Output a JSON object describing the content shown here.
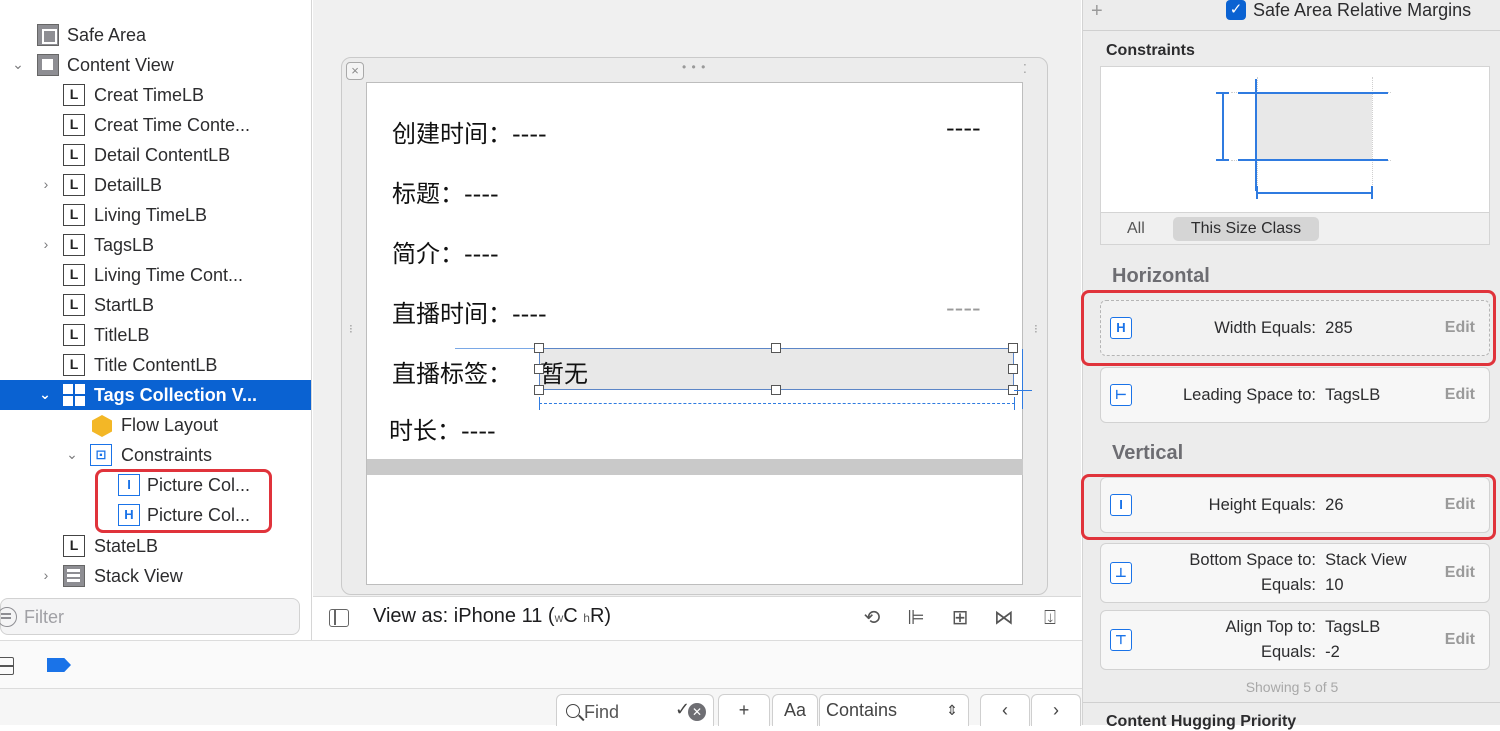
{
  "outline": {
    "items": [
      {
        "label": "Safe Area"
      },
      {
        "label": "Content View"
      },
      {
        "label": "Creat TimeLB"
      },
      {
        "label": "Creat Time Conte..."
      },
      {
        "label": "Detail ContentLB"
      },
      {
        "label": "DetailLB"
      },
      {
        "label": "Living TimeLB"
      },
      {
        "label": "TagsLB"
      },
      {
        "label": "Living Time Cont..."
      },
      {
        "label": "StartLB"
      },
      {
        "label": "TitleLB"
      },
      {
        "label": "Title ContentLB"
      },
      {
        "label": "Tags Collection V..."
      },
      {
        "label": "Flow Layout"
      },
      {
        "label": "Constraints"
      },
      {
        "label": "Picture Col..."
      },
      {
        "label": "Picture Col..."
      },
      {
        "label": "StateLB"
      },
      {
        "label": "Stack View"
      }
    ],
    "label_icon_letter": "L",
    "filter_placeholder": "Filter"
  },
  "canvas": {
    "rows": [
      {
        "label": "创建时间：----",
        "trailing": "----"
      },
      {
        "label": "标题：----"
      },
      {
        "label": "简介：----"
      },
      {
        "label": "直播时间：----",
        "trailing": "----"
      },
      {
        "label": "直播标签：",
        "value": "暂无"
      },
      {
        "label": "时长：----"
      }
    ],
    "view_as_prefix": "View as: iPhone 11 (",
    "view_as_w": "w",
    "view_as_c": "C",
    "view_as_h": "h",
    "view_as_r": "R",
    "view_as_suffix": ")"
  },
  "find_bar": {
    "placeholder": "Find",
    "aa_label": "Aa",
    "contains_label": "Contains",
    "add_label": "+"
  },
  "inspector": {
    "safe_area_label": "Safe Area Relative Margins",
    "constraints_title": "Constraints",
    "tab_all": "All",
    "tab_this_size_class": "This Size Class",
    "horizontal_header": "Horizontal",
    "vertical_header": "Vertical",
    "edit_label": "Edit",
    "constraints": [
      {
        "lines": [
          {
            "key": "Width Equals:",
            "val": "285"
          }
        ]
      },
      {
        "lines": [
          {
            "key": "Leading Space to:",
            "val": "TagsLB"
          }
        ]
      },
      {
        "lines": [
          {
            "key": "Height Equals:",
            "val": "26"
          }
        ]
      },
      {
        "lines": [
          {
            "key": "Bottom Space to:",
            "val": "Stack View"
          },
          {
            "key": "Equals:",
            "val": "10"
          }
        ]
      },
      {
        "lines": [
          {
            "key": "Align Top to:",
            "val": "TagsLB"
          },
          {
            "key": "Equals:",
            "val": "-2"
          }
        ]
      }
    ],
    "showing": "Showing 5 of 5",
    "hugging_title": "Content Hugging Priority"
  },
  "colors": {
    "selection_blue": "#0a62d2",
    "accent_blue": "#1a73e8",
    "highlight_red": "#e0333b"
  }
}
